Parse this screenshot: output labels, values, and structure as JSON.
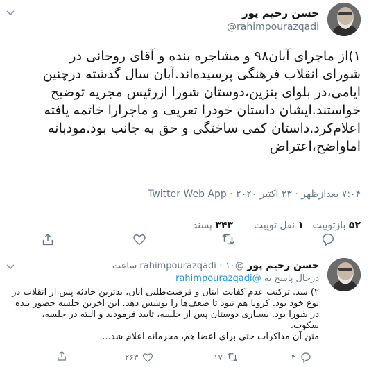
{
  "main_tweet": {
    "name": "حسن رحیم پور",
    "handle": "@rahimpourazqadi",
    "lines": [
      "۱)از ماجرای آبان۹۸ و مشاجره بنده و آقای روحانی در",
      "شورای انقلاب فرهنگی پرسیده‌اند.آبان سال گذشته درچنین",
      "ایامی،در بلوای بنزین،دوستان شورا ازرئیس مجریه توضیح",
      "خواستند.ایشان داستان خودرا تعریف و ماجرارا خاتمه یافته",
      "اعلام‌کرد.داستان کمی ساختگی و حق به جانب بود.مودبانه",
      "اماواضح،اعتراض"
    ],
    "time": "۷:۰۴ بعدازظهر · ۲۳ اکتبر ۲۰۲۰ · Twitter Web App",
    "stats": {
      "retweets_count": "۵۲",
      "retweets_label": "بازتوییت",
      "quotes_count": "۱",
      "quotes_label": "نقل‌ توییت",
      "likes_count": "۳۴۳",
      "likes_label": "پسند"
    }
  },
  "reply_tweet": {
    "name": "حسن رحیم پور",
    "handle": "@rahimpourazqadi",
    "time": "۱۰ ساعت",
    "replying_prefix": "درجال پاسخ به",
    "replying_handle": "@rahimpourazqadi",
    "lines": [
      "۲) شد. ترکیب عدم کفایت ابنان و فرصت‌طلبی آنان، بدترین حادثه پس از انقلاب در",
      "نوع خود بود. کرونا هم نبود تا ضعف‌ها را بوشش دهد. این آخرین جلسه حضور بنده",
      "در شورا بود. بسیاری دوستان پس از جلسه، تایید فرمودند و البته در جلسه،",
      "سکوت.",
      "متن آن مذاکرات حتی برای اعضا هم، محرمانه اعلام شد..."
    ],
    "counts": {
      "replies": "۳",
      "retweets": "۱۷",
      "likes": "۲۶۳"
    }
  }
}
